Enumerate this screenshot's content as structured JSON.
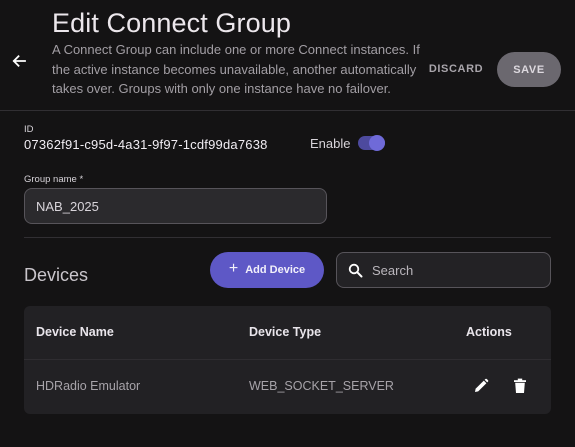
{
  "header": {
    "title": "Edit Connect Group",
    "description": "A Connect Group can include one or more Connect instances. If the active instance becomes unavailable, another automatically takes over. Groups with only one instance have no failover.",
    "discard_label": "DISCARD",
    "save_label": "SAVE",
    "back_icon": "arrow-left-icon"
  },
  "group": {
    "id_label": "ID",
    "id_value": "07362f91-c95d-4a31-9f97-1cdf99da7638",
    "enable_label": "Enable",
    "enabled": true,
    "name_label": "Group name *",
    "name_value": "NAB_2025"
  },
  "devices": {
    "title": "Devices",
    "add_label": "Add Device",
    "search_placeholder": "Search",
    "columns": [
      "Device Name",
      "Device Type",
      "Actions"
    ],
    "rows": [
      {
        "name": "HDRadio Emulator",
        "type": "WEB_SOCKET_SERVER"
      }
    ]
  },
  "colors": {
    "accent": "#5e58c6",
    "background": "#141314",
    "surface": "#222124"
  }
}
